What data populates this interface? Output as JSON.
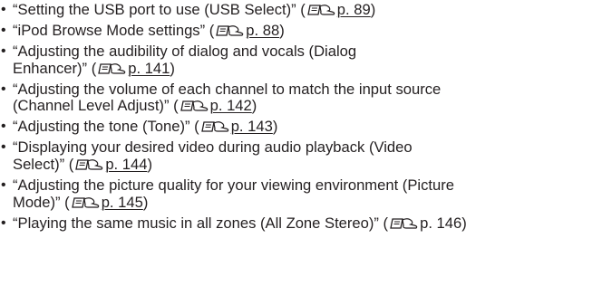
{
  "items": [
    {
      "text": "“Setting the USB port to use (USB Select)” (",
      "page_label": "p. 89",
      "suffix": ")",
      "link_underlined": true
    },
    {
      "text": "“iPod Browse Mode settings” (",
      "page_label": "p. 88",
      "suffix": ")",
      "link_underlined": true
    },
    {
      "line1": "“Adjusting the audibility of dialog and vocals (Dialog",
      "text": "Enhancer)” (",
      "page_label": "p. 141",
      "suffix": ")",
      "link_underlined": true
    },
    {
      "line1": "“Adjusting the volume of each channel to match the input source",
      "text": "(Channel Level Adjust)” (",
      "page_label": "p. 142",
      "suffix": ")",
      "link_underlined": true
    },
    {
      "text": "“Adjusting the tone (Tone)” (",
      "page_label": "p. 143",
      "suffix": ")",
      "link_underlined": true
    },
    {
      "line1": "“Displaying your desired video during audio playback (Video",
      "text": "Select)” (",
      "page_label": "p. 144",
      "suffix": ")",
      "link_underlined": true
    },
    {
      "line1": "“Adjusting the picture quality for your viewing environment (Picture",
      "text": "Mode)” (",
      "page_label": "p. 145",
      "suffix": ")",
      "link_underlined": true
    },
    {
      "text": "“Playing the same music in all zones (All Zone Stereo)” (",
      "page_label": "p. 146",
      "suffix": ")",
      "link_underlined": false
    }
  ],
  "bullet_glyph": "•",
  "icon": "page-reference-icon",
  "colors": {
    "text": "#231f20",
    "background": "#ffffff"
  }
}
